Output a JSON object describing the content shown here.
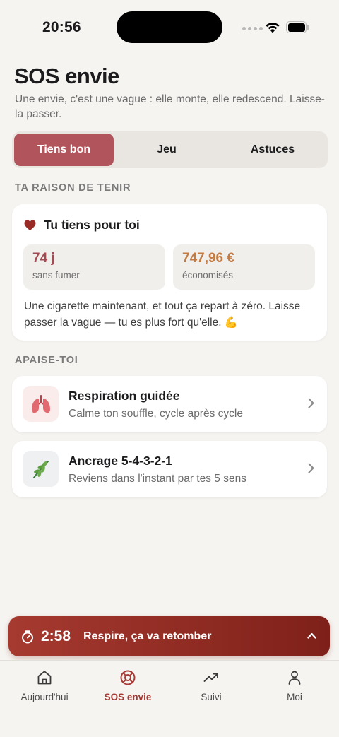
{
  "status_bar": {
    "time": "20:56"
  },
  "header": {
    "title": "SOS envie",
    "subtitle": "Une envie, c'est une vague : elle monte, elle redescend. Laisse-la passer."
  },
  "tabs": [
    {
      "label": "Tiens bon",
      "active": true
    },
    {
      "label": "Jeu",
      "active": false
    },
    {
      "label": "Astuces",
      "active": false
    }
  ],
  "reason": {
    "section_label": "TA RAISON DE TENIR",
    "heart_icon": "heart-icon",
    "title": "Tu tiens pour toi",
    "stats": [
      {
        "value": "74 j",
        "label": "sans fumer"
      },
      {
        "value": "747,96 €",
        "label": "économisés"
      }
    ],
    "message": "Une cigarette maintenant, et tout ça repart à zéro. Laisse passer la vague — tu es plus fort qu'elle. 💪"
  },
  "calm": {
    "section_label": "APAISE-TOI",
    "items": [
      {
        "icon": "🫁",
        "title": "Respiration guidée",
        "subtitle": "Calme ton souffle, cycle après cycle"
      },
      {
        "icon": "🌿",
        "title": "Ancrage 5-4-3-2-1",
        "subtitle": "Reviens dans l'instant par tes 5 sens"
      }
    ]
  },
  "timer": {
    "time": "2:58",
    "message": "Respire, ça va retomber"
  },
  "tab_bar": [
    {
      "label": "Aujourd'hui",
      "icon": "home-icon",
      "active": false
    },
    {
      "label": "SOS envie",
      "icon": "lifebuoy-icon",
      "active": true
    },
    {
      "label": "Suivi",
      "icon": "trend-up-icon",
      "active": false
    },
    {
      "label": "Moi",
      "icon": "person-icon",
      "active": false
    }
  ],
  "colors": {
    "accent": "#b2545c",
    "timer_banner": "#8f2d24",
    "days_value": "#a44a52",
    "money_value": "#c47a40",
    "background": "#f6f4f1"
  }
}
